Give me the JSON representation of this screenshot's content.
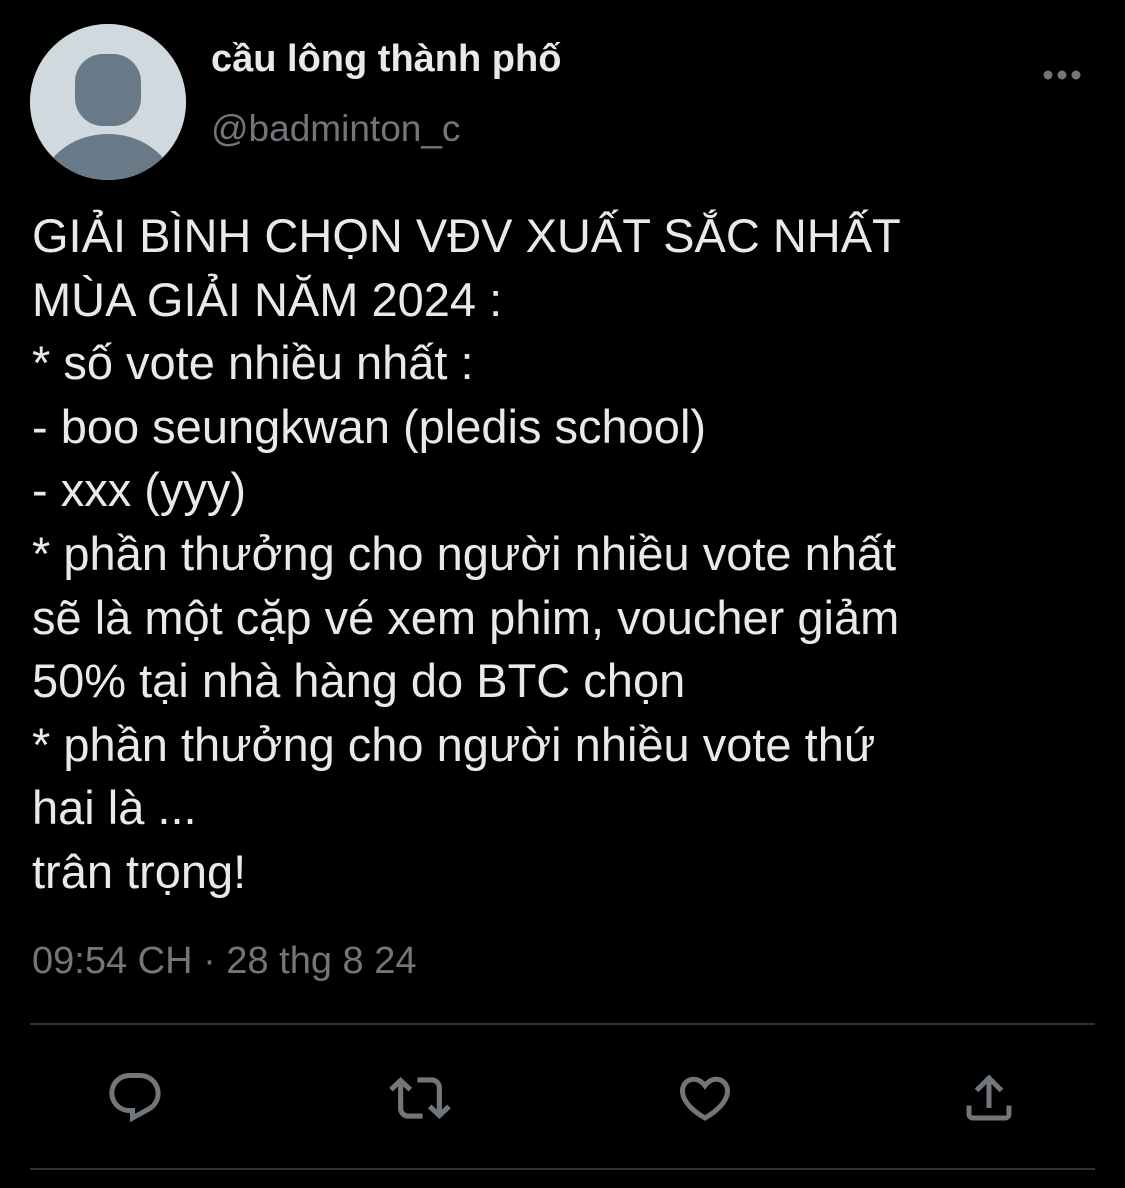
{
  "tweet": {
    "author": {
      "display_name": "cầu lông thành phố",
      "handle": "@badminton_c"
    },
    "text_lines": [
      "GIẢI BÌNH CHỌN VĐV XUẤT SẮC NHẤT",
      "MÙA GIẢI NĂM 2024 :",
      "* số vote nhiều nhất :",
      "- boo seungkwan (pledis school)",
      "- xxx (yyy)",
      "* phần thưởng cho người nhiều vote nhất",
      "sẽ là một cặp vé xem phim, voucher giảm",
      "50% tại nhà hàng do BTC chọn",
      "* phần thưởng cho người nhiều vote thứ",
      "hai là ...",
      "trân trọng!"
    ],
    "timestamp": "09:54 CH · 28 thg 8 24"
  },
  "icons": {
    "avatar": "default-avatar-icon",
    "more": "more-dots-icon",
    "reply": "reply-icon",
    "retweet": "retweet-icon",
    "like": "heart-icon",
    "share": "share-icon"
  },
  "colors": {
    "background": "#000000",
    "text_primary": "#e7e9ea",
    "text_secondary": "#71767b",
    "divider": "#2f3336",
    "avatar_bg": "#cfd9de",
    "avatar_figure": "#687987"
  }
}
